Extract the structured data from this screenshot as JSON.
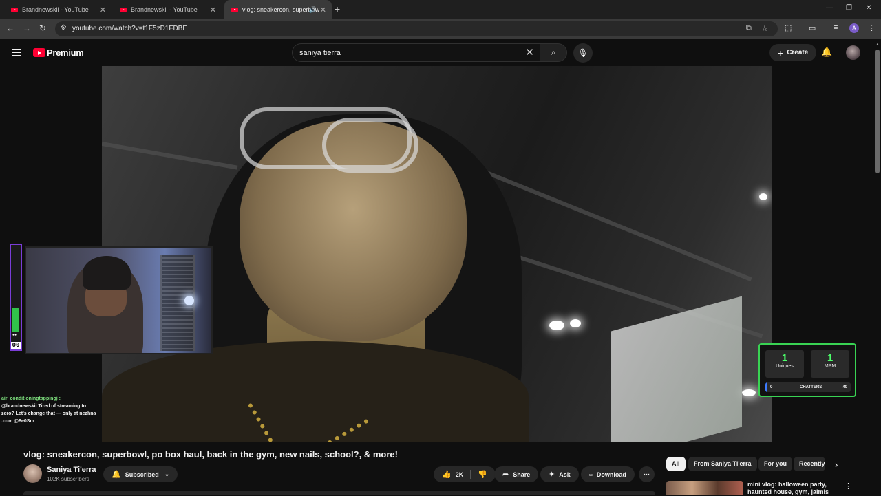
{
  "browser": {
    "tabs": [
      {
        "title": "Brandnewskii - YouTube"
      },
      {
        "title": "Brandnewskii - YouTube"
      },
      {
        "title": "vlog: sneakercon, superbow"
      }
    ],
    "url": "youtube.com/watch?v=t1F5zD1FDBE"
  },
  "youtube": {
    "brand": "Premium",
    "search_value": "saniya tierra",
    "create_label": "Create"
  },
  "overlay": {
    "mic_meter_value": "00",
    "mic_meter_level": 0.25,
    "chat": {
      "user": "air_conditioningtappingj :",
      "message": "@brandnewskii Tired of streaming to zero? Let's change that — only at nezhna .com @8e0Sm"
    },
    "stats": {
      "uniques_value": "1",
      "uniques_label": "Uniques",
      "mpm_value": "1",
      "mpm_label": "MPM",
      "chatters_label": "CHATTERS",
      "chatters_min": "0",
      "chatters_max": "40"
    }
  },
  "video": {
    "title": "vlog: sneakercon, superbowl, po box haul, back in the gym, new nails, school?, & more!",
    "channel": "Saniya Ti'erra",
    "subscribers": "102K subscribers",
    "subscribed_label": "Subscribed",
    "like_count": "2K",
    "share_label": "Share",
    "ask_label": "Ask",
    "download_label": "Download"
  },
  "sidebar": {
    "chips": [
      "All",
      "From Saniya Ti'erra",
      "For you",
      "Recently"
    ],
    "rec_title": "mini vlog: halloween party, haunted house, gym, jaimis"
  }
}
